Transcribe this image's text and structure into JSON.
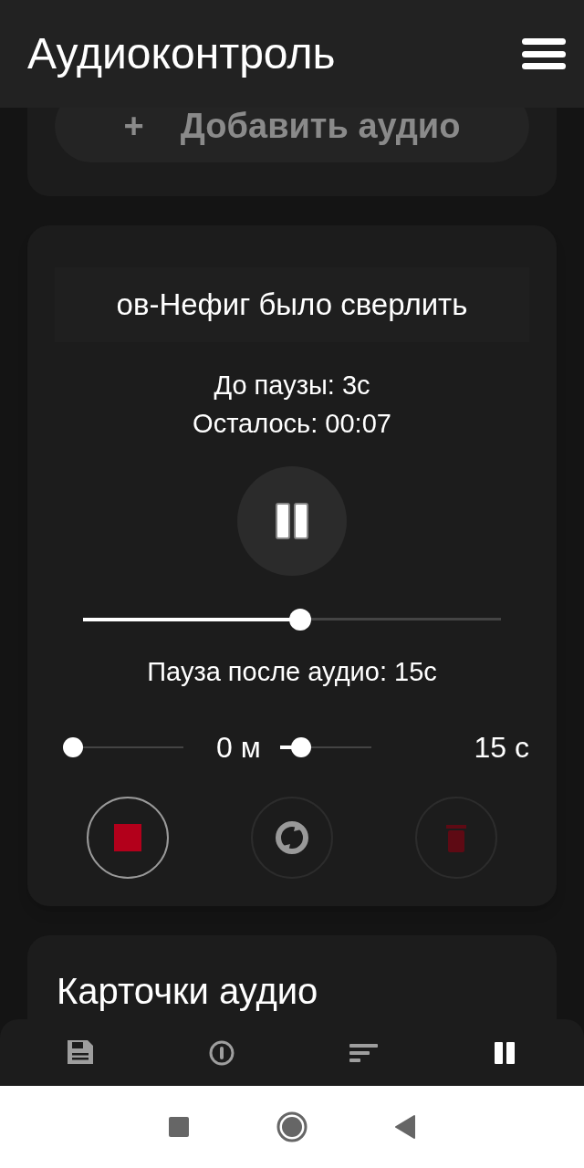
{
  "app_bar": {
    "title": "Аудиоконтроль"
  },
  "add_card": {
    "button": {
      "icon": "+",
      "label": "Добавить аудио",
      "disabled": true
    }
  },
  "player_card": {
    "track_title": "ов-Нефиг было сверлить",
    "until_pause": "До паузы: 3с",
    "remaining": "Осталось: 00:07",
    "progress": {
      "level": 0.52
    },
    "pause_after_label": "Пауза после аудио: 15с",
    "minutes": {
      "level": 0,
      "value": "0",
      "unit": "м"
    },
    "seconds": {
      "level": 0.23,
      "value": "15",
      "unit": "с"
    },
    "actions": [
      {
        "kind": "stop",
        "disabled": false
      },
      {
        "kind": "repeat",
        "disabled": true
      },
      {
        "kind": "delete",
        "disabled": true
      }
    ]
  },
  "cards_section": {
    "title": "Карточки аудио"
  },
  "bottom_nav": [
    {
      "kind": "save",
      "selected": false
    },
    {
      "kind": "info",
      "selected": false
    },
    {
      "kind": "sort",
      "selected": false
    },
    {
      "kind": "pause",
      "selected": true
    }
  ]
}
